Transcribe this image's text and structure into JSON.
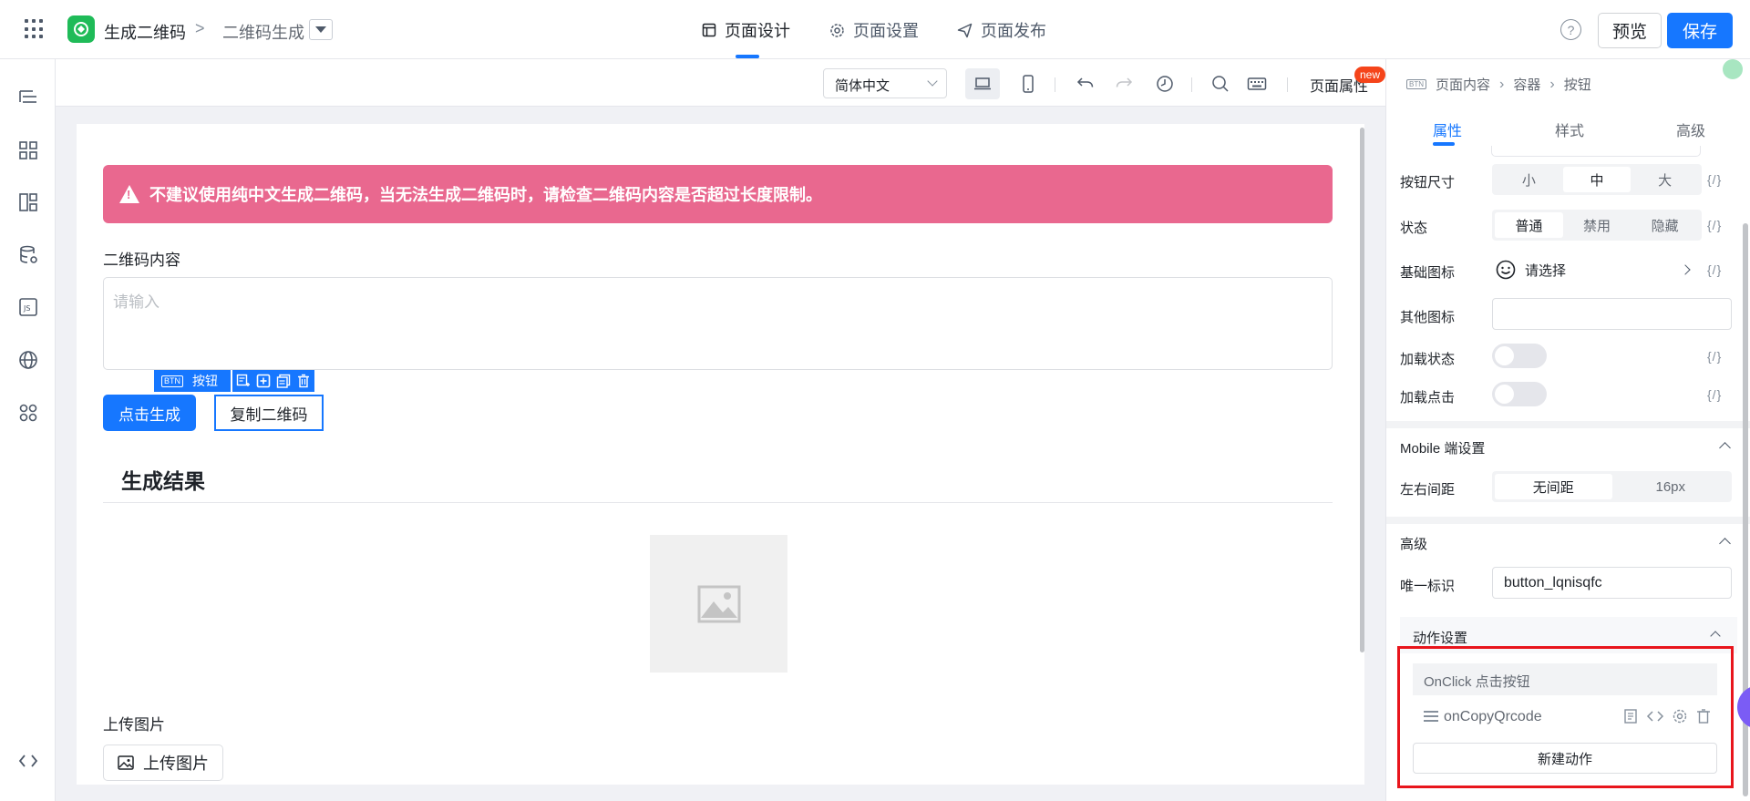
{
  "header": {
    "app_name": "生成二维码",
    "crumb_sep": ">",
    "page_name": "二维码生成",
    "nav": [
      {
        "label": "页面设计"
      },
      {
        "label": "页面设置"
      },
      {
        "label": "页面发布"
      }
    ],
    "help": "?",
    "preview_label": "预览",
    "save_label": "保存"
  },
  "toolbar": {
    "language": "简体中文",
    "page_attr_label": "页面属性",
    "new_badge": "new"
  },
  "canvas": {
    "alert_text": "不建议使用纯中文生成二维码，当无法生成二维码时，请检查二维码内容是否超过长度限制。",
    "qr_content_label": "二维码内容",
    "qr_content_placeholder": "请输入",
    "selected_tag": "按钮",
    "selected_tag_chip": "BTN",
    "generate_button": "点击生成",
    "copy_button": "复制二维码",
    "result_title": "生成结果",
    "upload_label": "上传图片",
    "upload_button": "上传图片"
  },
  "right_panel": {
    "breadcrumb": [
      "页面内容",
      "容器",
      "按钮"
    ],
    "crumb_chip": "BTN",
    "tabs": [
      {
        "label": "属性"
      },
      {
        "label": "样式"
      },
      {
        "label": "高级"
      }
    ],
    "expr": "{/}",
    "button_size": {
      "label": "按钮尺寸",
      "options": [
        "小",
        "中",
        "大"
      ],
      "selected": "中"
    },
    "state": {
      "label": "状态",
      "options": [
        "普通",
        "禁用",
        "隐藏"
      ],
      "selected": "普通"
    },
    "basic_icon": {
      "label": "基础图标",
      "value": "请选择"
    },
    "other_icon": {
      "label": "其他图标",
      "value": ""
    },
    "loading_state": {
      "label": "加载状态",
      "value": false
    },
    "loading_click": {
      "label": "加载点击",
      "value": false
    },
    "mobile_section": "Mobile 端设置",
    "side_padding": {
      "label": "左右间距",
      "options": [
        "无间距",
        "16px"
      ],
      "selected": "无间距"
    },
    "advanced_section": "高级",
    "unique_id": {
      "label": "唯一标识",
      "value": "button_lqnisqfc"
    },
    "action_section": "动作设置",
    "event_head": "OnClick 点击按钮",
    "event_action": "onCopyQrcode",
    "new_action_button": "新建动作"
  },
  "colors": {
    "primary": "#1677ff",
    "alert": "#e9688f",
    "highlight": "#e8151c",
    "logo": "#1fbb58"
  }
}
